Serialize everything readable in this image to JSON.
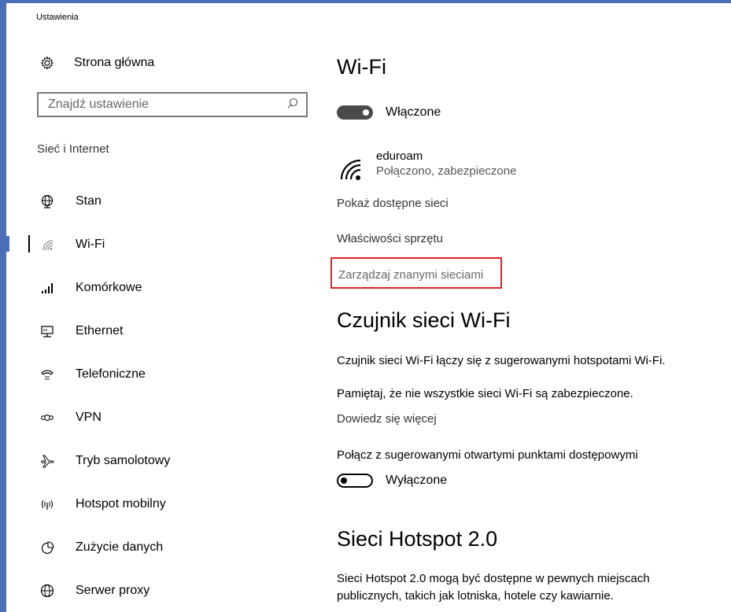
{
  "window": {
    "title": "Ustawienia",
    "accent": "#4a6fb6"
  },
  "sidebar": {
    "home_label": "Strona główna",
    "search_placeholder": "Znajdź ustawienie",
    "section_label": "Sieć i Internet",
    "items": [
      {
        "label": "Stan",
        "icon": "globe-status-icon"
      },
      {
        "label": "Wi-Fi",
        "icon": "wifi-icon",
        "active": true
      },
      {
        "label": "Komórkowe",
        "icon": "cellular-icon"
      },
      {
        "label": "Ethernet",
        "icon": "ethernet-icon"
      },
      {
        "label": "Telefoniczne",
        "icon": "dialup-icon"
      },
      {
        "label": "VPN",
        "icon": "vpn-icon"
      },
      {
        "label": "Tryb samolotowy",
        "icon": "airplane-icon"
      },
      {
        "label": "Hotspot mobilny",
        "icon": "hotspot-icon"
      },
      {
        "label": "Zużycie danych",
        "icon": "data-usage-icon"
      },
      {
        "label": "Serwer proxy",
        "icon": "globe-icon"
      }
    ]
  },
  "main": {
    "wifi_title": "Wi-Fi",
    "wifi_toggle_label": "Włączone",
    "network_name": "eduroam",
    "network_status": "Połączono, zabezpieczone",
    "show_networks_link": "Pokaż dostępne sieci",
    "hardware_props_link": "Właściwości sprzętu",
    "manage_link": "Zarządzaj znanymi sieciami",
    "sense_title": "Czujnik sieci Wi-Fi",
    "sense_desc": "Czujnik sieci Wi-Fi łączy się z sugerowanymi hotspotami Wi-Fi.",
    "sense_warning": "Pamiętaj, że nie wszystkie sieci Wi-Fi są zabezpieczone.",
    "learn_more_link": "Dowiedz się więcej",
    "connect_suggested_label": "Połącz z sugerowanymi otwartymi punktami dostępowymi",
    "suggested_toggle_label": "Wyłączone",
    "hotspot20_title": "Sieci Hotspot 2.0",
    "hotspot20_desc_line1": "Sieci Hotspot 2.0 mogą być dostępne w pewnych miejscach",
    "hotspot20_desc_line2": "publicznych, takich jak lotniska, hotele czy kawiarnie."
  }
}
